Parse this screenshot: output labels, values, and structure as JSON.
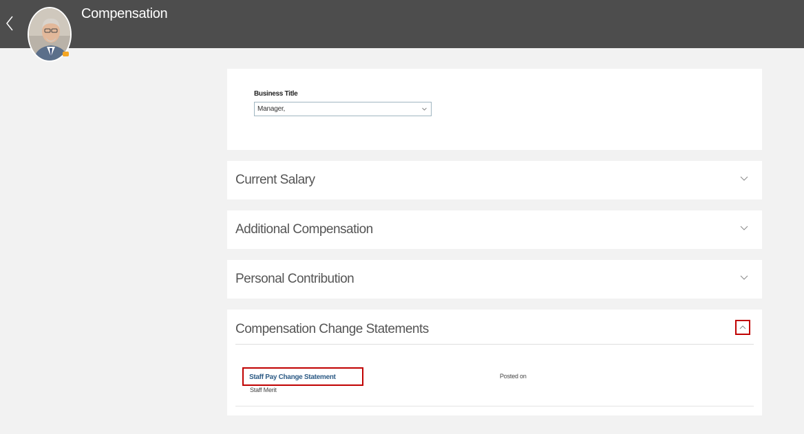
{
  "header": {
    "title": "Compensation",
    "back_icon": "chevron-left-icon",
    "avatar_icon": "user-avatar-photo",
    "accent": "#4d4d4d"
  },
  "business_title": {
    "label": "Business Title",
    "value": "Manager,"
  },
  "sections": {
    "current_salary": "Current Salary",
    "additional_compensation": "Additional Compensation",
    "personal_contribution": "Personal Contribution",
    "compensation_change_statements": "Compensation Change Statements"
  },
  "statements": {
    "items": [
      {
        "title": "Staff Pay Change Statement",
        "subtitle": "Staff Merit",
        "posted_label": "Posted on"
      }
    ]
  },
  "colors": {
    "highlight": "#c00000",
    "link": "#2e5c86"
  }
}
